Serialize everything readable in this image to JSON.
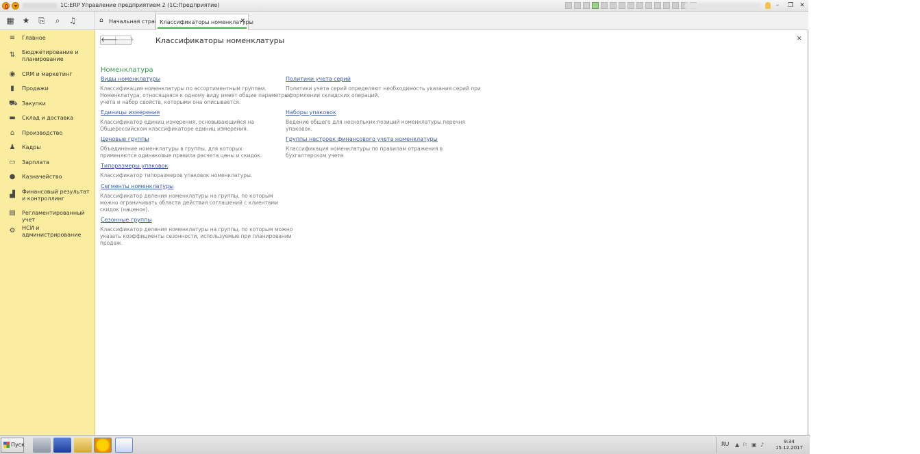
{
  "window": {
    "title": "1C:ERP Управление предприятием 2  (1С:Предприятие)"
  },
  "tabs": [
    {
      "label": "Начальная страница",
      "active": false
    },
    {
      "label": "Классификаторы номенклатуры",
      "active": true
    }
  ],
  "sidebar": {
    "items": [
      {
        "label": "Главное",
        "icon": "menu-lines-icon"
      },
      {
        "label": "Бюджетирование и планирование",
        "icon": "budget-icon"
      },
      {
        "label": "CRM и маркетинг",
        "icon": "crm-icon"
      },
      {
        "label": "Продажи",
        "icon": "sales-icon"
      },
      {
        "label": "Закупки",
        "icon": "cart-icon"
      },
      {
        "label": "Склад и доставка",
        "icon": "warehouse-icon"
      },
      {
        "label": "Производство",
        "icon": "factory-icon"
      },
      {
        "label": "Кадры",
        "icon": "people-icon"
      },
      {
        "label": "Зарплата",
        "icon": "salary-icon"
      },
      {
        "label": "Казначейство",
        "icon": "treasury-icon"
      },
      {
        "label": "Финансовый результат и контроллинг",
        "icon": "chart-icon"
      },
      {
        "label": "Регламентированный учет",
        "icon": "ledger-icon"
      },
      {
        "label": "НСИ и администрирование",
        "icon": "gear-icon"
      }
    ]
  },
  "page": {
    "title": "Классификаторы номенклатуры",
    "section_title": "Номенклатура"
  },
  "left_entries": [
    {
      "link": "Виды номенклатуры",
      "desc": [
        "Классификация номенклатуры по ассортиментным группам.",
        "Номенклатура, относящаяся к одному виду имеет общие параметры",
        "учета и набор свойств, которыми она описывается."
      ]
    },
    {
      "link": "Единицы измерения",
      "desc": [
        "Классификатор единиц измерения, основывающийся на",
        "Общероссийском классификаторе единиц измерения."
      ]
    },
    {
      "link": "Ценовые группы",
      "desc": [
        "Объединение номенклатуры в группы, для которых",
        "применяются одинаковые правила расчета цены и скидок."
      ]
    },
    {
      "link": "Типоразмеры упаковок",
      "desc": [
        "Классификатор типоразмеров упаковок номенклатуры."
      ]
    },
    {
      "link": "Сегменты номенклатуры",
      "desc": [
        "Классификатор деления номенклатуры на группы, по которым",
        "можно ограничивать области действия соглашений с клиентами",
        "скидок (наценок)."
      ]
    },
    {
      "link": "Сезонные группы",
      "desc": [
        "Классификатор деления номенклатуры на группы, по которым можно",
        "указать коэффициенты сезонности, используемые при планировании",
        "продаж."
      ]
    }
  ],
  "right_entries": [
    {
      "link": "Политики учета серий",
      "desc": [
        "Политики учета серий определяют необходимость указания серий при",
        "оформлении складских операций."
      ]
    },
    {
      "link": "Наборы упаковок",
      "desc": [
        "Ведение общего для нескольких позиций номенклатуры перечня",
        "упаковок."
      ]
    },
    {
      "link": "Группы настроек финансового учета номенклатуры",
      "desc": [
        "Классификация номенклатуры по правилам отражения в",
        "бухгалтерском учете"
      ]
    }
  ],
  "taskbar": {
    "start_label": "Пуск",
    "lang": "RU",
    "time": "9:34",
    "date": "15.12.2017"
  },
  "colors": {
    "sidebar_bg": "#fbeda0",
    "section_green": "#3a9b52",
    "link_blue": "#3b5ca8",
    "tab_accent": "#4aa84a"
  }
}
